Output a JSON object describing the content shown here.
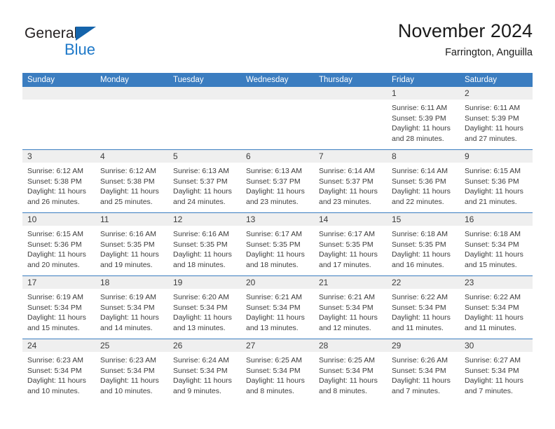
{
  "brand": {
    "name_top": "General",
    "name_bottom": "Blue",
    "triangle_icon": "blue-triangle-icon",
    "colors": {
      "dark": "#231f20",
      "blue": "#1d78c8",
      "triangle": "#1464ab"
    }
  },
  "header": {
    "title": "November 2024",
    "location": "Farrington, Anguilla"
  },
  "calendar": {
    "header_bg": "#3b7dc0",
    "header_text": "#ffffff",
    "day_band_bg": "#efefef",
    "weekdays": [
      "Sunday",
      "Monday",
      "Tuesday",
      "Wednesday",
      "Thursday",
      "Friday",
      "Saturday"
    ],
    "weeks": [
      [
        {
          "day": "",
          "empty": true
        },
        {
          "day": "",
          "empty": true
        },
        {
          "day": "",
          "empty": true
        },
        {
          "day": "",
          "empty": true
        },
        {
          "day": "",
          "empty": true
        },
        {
          "day": "1",
          "sunrise": "Sunrise: 6:11 AM",
          "sunset": "Sunset: 5:39 PM",
          "daylight1": "Daylight: 11 hours",
          "daylight2": "and 28 minutes."
        },
        {
          "day": "2",
          "sunrise": "Sunrise: 6:11 AM",
          "sunset": "Sunset: 5:39 PM",
          "daylight1": "Daylight: 11 hours",
          "daylight2": "and 27 minutes."
        }
      ],
      [
        {
          "day": "3",
          "sunrise": "Sunrise: 6:12 AM",
          "sunset": "Sunset: 5:38 PM",
          "daylight1": "Daylight: 11 hours",
          "daylight2": "and 26 minutes."
        },
        {
          "day": "4",
          "sunrise": "Sunrise: 6:12 AM",
          "sunset": "Sunset: 5:38 PM",
          "daylight1": "Daylight: 11 hours",
          "daylight2": "and 25 minutes."
        },
        {
          "day": "5",
          "sunrise": "Sunrise: 6:13 AM",
          "sunset": "Sunset: 5:37 PM",
          "daylight1": "Daylight: 11 hours",
          "daylight2": "and 24 minutes."
        },
        {
          "day": "6",
          "sunrise": "Sunrise: 6:13 AM",
          "sunset": "Sunset: 5:37 PM",
          "daylight1": "Daylight: 11 hours",
          "daylight2": "and 23 minutes."
        },
        {
          "day": "7",
          "sunrise": "Sunrise: 6:14 AM",
          "sunset": "Sunset: 5:37 PM",
          "daylight1": "Daylight: 11 hours",
          "daylight2": "and 23 minutes."
        },
        {
          "day": "8",
          "sunrise": "Sunrise: 6:14 AM",
          "sunset": "Sunset: 5:36 PM",
          "daylight1": "Daylight: 11 hours",
          "daylight2": "and 22 minutes."
        },
        {
          "day": "9",
          "sunrise": "Sunrise: 6:15 AM",
          "sunset": "Sunset: 5:36 PM",
          "daylight1": "Daylight: 11 hours",
          "daylight2": "and 21 minutes."
        }
      ],
      [
        {
          "day": "10",
          "sunrise": "Sunrise: 6:15 AM",
          "sunset": "Sunset: 5:36 PM",
          "daylight1": "Daylight: 11 hours",
          "daylight2": "and 20 minutes."
        },
        {
          "day": "11",
          "sunrise": "Sunrise: 6:16 AM",
          "sunset": "Sunset: 5:35 PM",
          "daylight1": "Daylight: 11 hours",
          "daylight2": "and 19 minutes."
        },
        {
          "day": "12",
          "sunrise": "Sunrise: 6:16 AM",
          "sunset": "Sunset: 5:35 PM",
          "daylight1": "Daylight: 11 hours",
          "daylight2": "and 18 minutes."
        },
        {
          "day": "13",
          "sunrise": "Sunrise: 6:17 AM",
          "sunset": "Sunset: 5:35 PM",
          "daylight1": "Daylight: 11 hours",
          "daylight2": "and 18 minutes."
        },
        {
          "day": "14",
          "sunrise": "Sunrise: 6:17 AM",
          "sunset": "Sunset: 5:35 PM",
          "daylight1": "Daylight: 11 hours",
          "daylight2": "and 17 minutes."
        },
        {
          "day": "15",
          "sunrise": "Sunrise: 6:18 AM",
          "sunset": "Sunset: 5:35 PM",
          "daylight1": "Daylight: 11 hours",
          "daylight2": "and 16 minutes."
        },
        {
          "day": "16",
          "sunrise": "Sunrise: 6:18 AM",
          "sunset": "Sunset: 5:34 PM",
          "daylight1": "Daylight: 11 hours",
          "daylight2": "and 15 minutes."
        }
      ],
      [
        {
          "day": "17",
          "sunrise": "Sunrise: 6:19 AM",
          "sunset": "Sunset: 5:34 PM",
          "daylight1": "Daylight: 11 hours",
          "daylight2": "and 15 minutes."
        },
        {
          "day": "18",
          "sunrise": "Sunrise: 6:19 AM",
          "sunset": "Sunset: 5:34 PM",
          "daylight1": "Daylight: 11 hours",
          "daylight2": "and 14 minutes."
        },
        {
          "day": "19",
          "sunrise": "Sunrise: 6:20 AM",
          "sunset": "Sunset: 5:34 PM",
          "daylight1": "Daylight: 11 hours",
          "daylight2": "and 13 minutes."
        },
        {
          "day": "20",
          "sunrise": "Sunrise: 6:21 AM",
          "sunset": "Sunset: 5:34 PM",
          "daylight1": "Daylight: 11 hours",
          "daylight2": "and 13 minutes."
        },
        {
          "day": "21",
          "sunrise": "Sunrise: 6:21 AM",
          "sunset": "Sunset: 5:34 PM",
          "daylight1": "Daylight: 11 hours",
          "daylight2": "and 12 minutes."
        },
        {
          "day": "22",
          "sunrise": "Sunrise: 6:22 AM",
          "sunset": "Sunset: 5:34 PM",
          "daylight1": "Daylight: 11 hours",
          "daylight2": "and 11 minutes."
        },
        {
          "day": "23",
          "sunrise": "Sunrise: 6:22 AM",
          "sunset": "Sunset: 5:34 PM",
          "daylight1": "Daylight: 11 hours",
          "daylight2": "and 11 minutes."
        }
      ],
      [
        {
          "day": "24",
          "sunrise": "Sunrise: 6:23 AM",
          "sunset": "Sunset: 5:34 PM",
          "daylight1": "Daylight: 11 hours",
          "daylight2": "and 10 minutes."
        },
        {
          "day": "25",
          "sunrise": "Sunrise: 6:23 AM",
          "sunset": "Sunset: 5:34 PM",
          "daylight1": "Daylight: 11 hours",
          "daylight2": "and 10 minutes."
        },
        {
          "day": "26",
          "sunrise": "Sunrise: 6:24 AM",
          "sunset": "Sunset: 5:34 PM",
          "daylight1": "Daylight: 11 hours",
          "daylight2": "and 9 minutes."
        },
        {
          "day": "27",
          "sunrise": "Sunrise: 6:25 AM",
          "sunset": "Sunset: 5:34 PM",
          "daylight1": "Daylight: 11 hours",
          "daylight2": "and 8 minutes."
        },
        {
          "day": "28",
          "sunrise": "Sunrise: 6:25 AM",
          "sunset": "Sunset: 5:34 PM",
          "daylight1": "Daylight: 11 hours",
          "daylight2": "and 8 minutes."
        },
        {
          "day": "29",
          "sunrise": "Sunrise: 6:26 AM",
          "sunset": "Sunset: 5:34 PM",
          "daylight1": "Daylight: 11 hours",
          "daylight2": "and 7 minutes."
        },
        {
          "day": "30",
          "sunrise": "Sunrise: 6:27 AM",
          "sunset": "Sunset: 5:34 PM",
          "daylight1": "Daylight: 11 hours",
          "daylight2": "and 7 minutes."
        }
      ]
    ]
  }
}
